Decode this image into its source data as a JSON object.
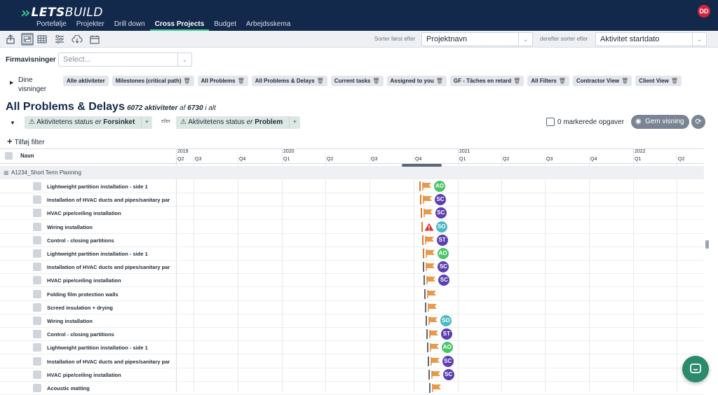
{
  "brand": {
    "logo_lets": "LETS",
    "logo_build": "BUILD"
  },
  "nav": {
    "tabs": [
      "Portefølje",
      "Projekter",
      "Drill down",
      "Cross Projects",
      "Budget",
      "Arbejdsskema"
    ],
    "active_index": 3
  },
  "user": {
    "initials": "DD"
  },
  "sort": {
    "first_label": "Sorter først efter",
    "first_value": "Projektnavn",
    "then_label": "derefter sorter efter",
    "then_value": "Aktivitet startdato"
  },
  "firma": {
    "label": "Firmavisninger",
    "placeholder": "Select..."
  },
  "dine": {
    "label": "Dine visninger"
  },
  "views": [
    {
      "label": "Alle aktiviteter",
      "trash": false
    },
    {
      "label": "Milestones (critical path)",
      "trash": true
    },
    {
      "label": "All Problems",
      "trash": true
    },
    {
      "label": "All Problems & Delays",
      "trash": true
    },
    {
      "label": "Current tasks",
      "trash": true
    },
    {
      "label": "Assigned to you",
      "trash": true
    },
    {
      "label": "GF - Tâches en retard",
      "trash": true
    },
    {
      "label": "All Filters",
      "trash": true
    },
    {
      "label": "Contractor View",
      "trash": true
    },
    {
      "label": "Client View",
      "trash": true
    }
  ],
  "title": {
    "main": "All Problems & Delays",
    "count": "6072 aktiviteter",
    "af": "af",
    "total": "6730",
    "suffix": "i alt"
  },
  "filters": {
    "f1_prefix": "Aktivitetens status",
    "f1_er": "er",
    "f1_value": "Forsinket",
    "eller": "eller",
    "f2_prefix": "Aktivitetens status",
    "f2_er": "er",
    "f2_value": "Problem",
    "add": "Tilføj filter"
  },
  "markerede": "0 markerede opgaver",
  "gem": "Gem visning",
  "grid": {
    "name_header": "Navn",
    "years": [
      "2019",
      "2020",
      "2021",
      "2022"
    ],
    "quarters": [
      "Q2",
      "Q3",
      "Q4",
      "Q1",
      "Q2",
      "Q3",
      "Q4",
      "Q1",
      "Q2",
      "Q3",
      "Q4",
      "Q1",
      "Q2"
    ],
    "group": "A1234_Short Term Planning",
    "tasks": [
      {
        "name": "Lightweight partition installation - side 1",
        "avatar": "AO",
        "warn": false
      },
      {
        "name": "Installation of HVAC ducts and pipes/sanitary par",
        "avatar": "SC",
        "warn": false
      },
      {
        "name": "HVAC pipe/ceiling installation",
        "avatar": "SC",
        "warn": false
      },
      {
        "name": "Wiring installation",
        "avatar": "SO",
        "warn": true
      },
      {
        "name": "Control - closing partitions",
        "avatar": "ST",
        "warn": false
      },
      {
        "name": "Lightweight partition installation - side 1",
        "avatar": "AO",
        "warn": false
      },
      {
        "name": "Installation of HVAC ducts and pipes/sanitary par",
        "avatar": "SC",
        "warn": false
      },
      {
        "name": "HVAC pipe/ceiling installation",
        "avatar": "SC",
        "warn": false
      },
      {
        "name": "Folding film protection walls",
        "avatar": "",
        "warn": false
      },
      {
        "name": "Screed insulation + drying",
        "avatar": "",
        "warn": false
      },
      {
        "name": "Wiring installation",
        "avatar": "SO",
        "warn": false
      },
      {
        "name": "Control - closing partitions",
        "avatar": "ST",
        "warn": false
      },
      {
        "name": "Lightweight partition installation - side 1",
        "avatar": "AO",
        "warn": false
      },
      {
        "name": "Installation of HVAC ducts and pipes/sanitary par",
        "avatar": "SC",
        "warn": false
      },
      {
        "name": "HVAC pipe/ceiling installation",
        "avatar": "SC",
        "warn": false
      },
      {
        "name": "Acoustic matting",
        "avatar": "",
        "warn": false
      }
    ]
  },
  "colors": {
    "nav_bg": "#13294b",
    "accent": "#3fd08c",
    "flag": "#e89a4a",
    "avatar_AO": "#4cc46a",
    "avatar_SC": "#5b3fb0",
    "avatar_SO": "#4ab8c4",
    "avatar_ST": "#5b3fb0",
    "warn": "#d9342b"
  }
}
